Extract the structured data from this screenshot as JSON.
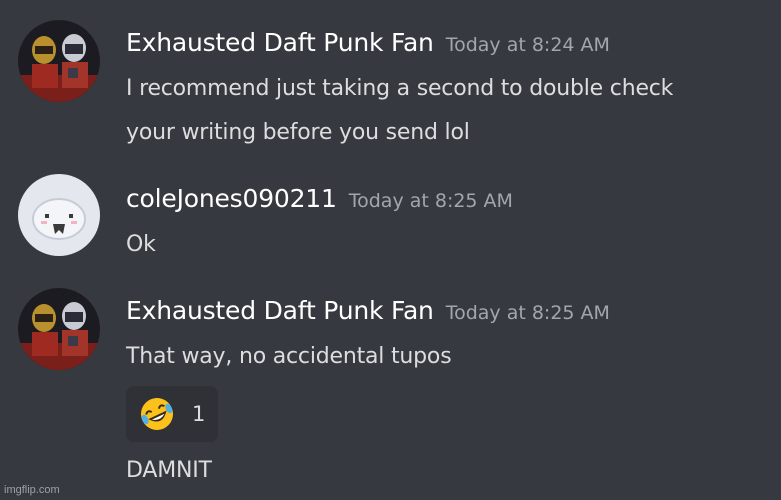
{
  "messages": [
    {
      "author": "Exhausted Daft Punk Fan",
      "timestamp": "Today at 8:24 AM",
      "lines": [
        "I recommend just taking a second to double check",
        "your writing before you send lol"
      ]
    },
    {
      "author": "coleJones090211",
      "timestamp": "Today at 8:25 AM",
      "lines": [
        "Ok"
      ]
    },
    {
      "author": "Exhausted Daft Punk Fan",
      "timestamp": "Today at 8:25 AM",
      "lines": [
        "That way, no accidental tupos"
      ],
      "reaction": {
        "emoji": "rolling-on-floor-laughing-emoji",
        "count": "1"
      },
      "followup": "DAMNIT"
    }
  ],
  "watermark": "imgflip.com",
  "colors": {
    "background": "#36393f",
    "author": "#ffffff",
    "text": "#dcddde",
    "timestamp": "#a3a6aa",
    "reaction_bg": "#2f3136"
  }
}
